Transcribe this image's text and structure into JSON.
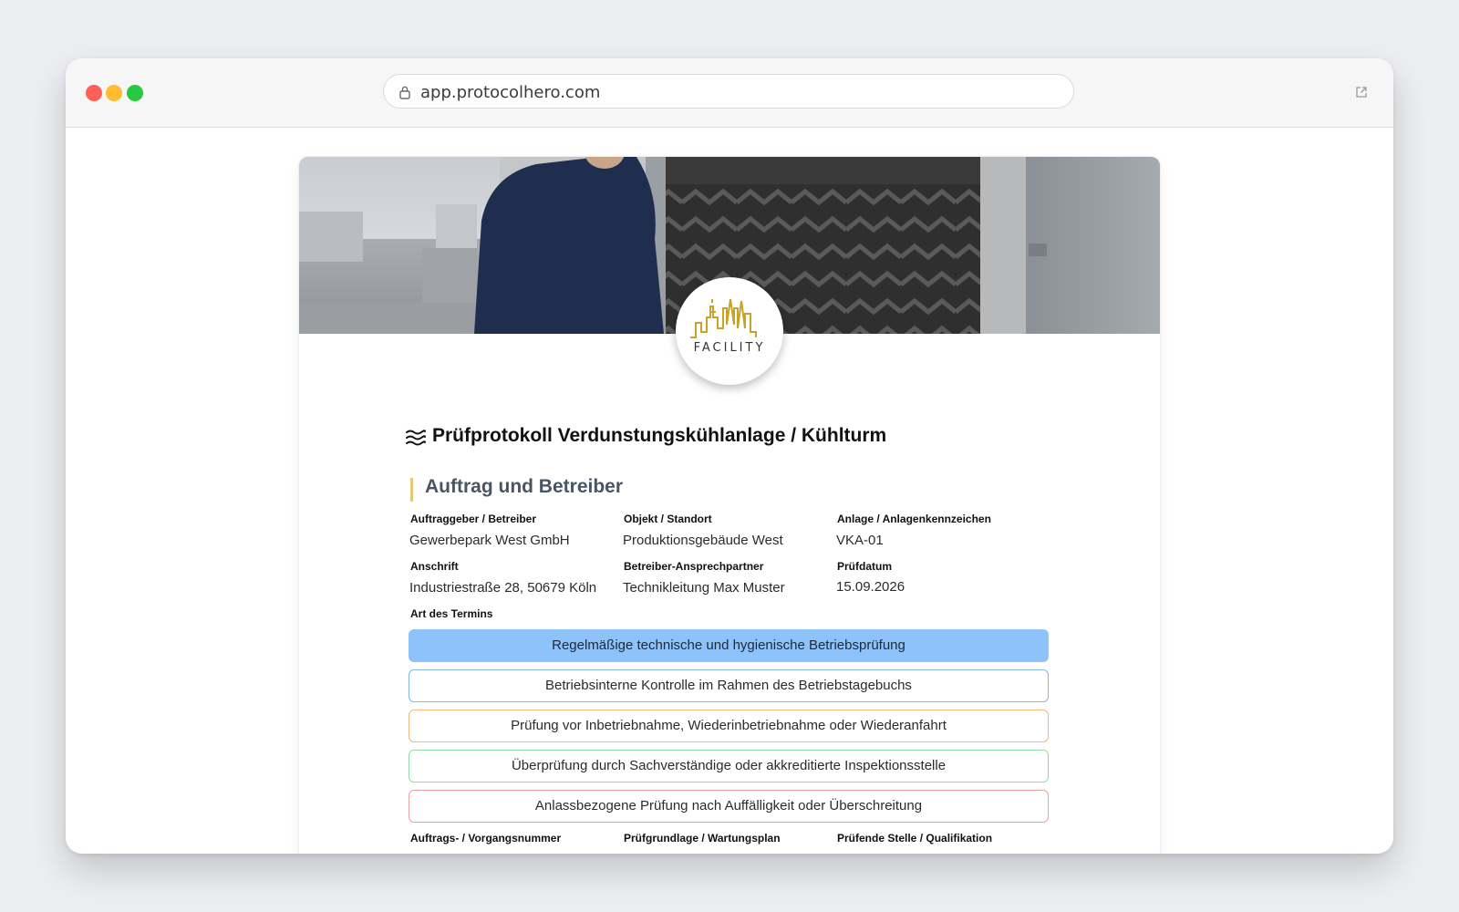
{
  "browser": {
    "url": "app.protocolhero.com"
  },
  "logo": {
    "text": "FACILITY",
    "color": "#c9a227"
  },
  "document": {
    "title": "Prüfprotokoll Verdunstungskühlanlage / Kühlturm",
    "title_icon": "waves-icon"
  },
  "section": {
    "title": "Auftrag und Betreiber",
    "accent": "#e5c97b"
  },
  "fields": {
    "auftraggeber": {
      "label": "Auftraggeber / Betreiber",
      "value": "Gewerbepark West GmbH"
    },
    "objekt": {
      "label": "Objekt / Standort",
      "value": "Produktionsgebäude West"
    },
    "anlage": {
      "label": "Anlage / Anlagenkennzeichen",
      "value": "VKA-01"
    },
    "anschrift": {
      "label": "Anschrift",
      "value": "Industriestraße 28, 50679 Köln"
    },
    "ansprechpartner": {
      "label": "Betreiber-Ansprechpartner",
      "value": "Technikleitung Max Muster"
    },
    "pruefdatum": {
      "label": "Prüfdatum",
      "value": "15.09.2026"
    },
    "art_label": "Art des Termins",
    "auftragsnummer": {
      "label": "Auftrags- / Vorgangsnummer"
    },
    "pruefgrundlage": {
      "label": "Prüfgrundlage / Wartungsplan"
    },
    "pruefende_stelle": {
      "label": "Prüfende Stelle / Qualifikation"
    }
  },
  "termin_options": [
    {
      "label": "Regelmäßige technische und hygienische Betriebsprüfung",
      "color": "#8ec2fa",
      "selected": true
    },
    {
      "label": "Betriebsinterne Kontrolle im Rahmen des Betriebstagebuchs",
      "color": "#7fb7ee",
      "selected": false
    },
    {
      "label": "Prüfung vor Inbetriebnahme, Wiederinbetriebnahme oder Wiederanfahrt",
      "color": "#f3b77a",
      "selected": false
    },
    {
      "label": "Überprüfung durch Sachverständige oder akkreditierte Inspektionsstelle",
      "color": "#8fdba8",
      "selected": false
    },
    {
      "label": "Anlassbezogene Prüfung nach Auffälligkeit oder Überschreitung",
      "color": "#f0a0a0",
      "selected": false
    }
  ]
}
